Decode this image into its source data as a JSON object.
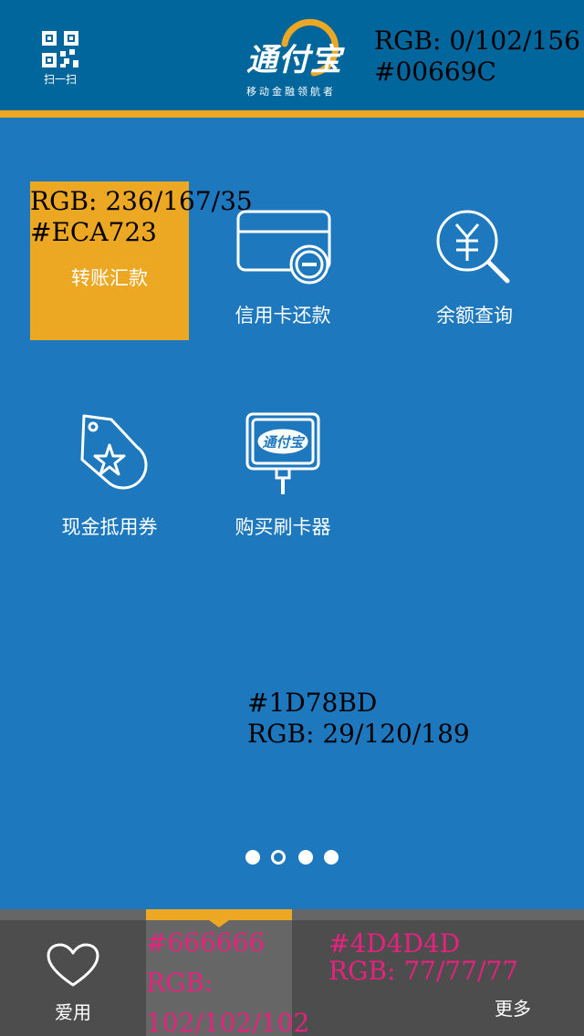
{
  "header": {
    "scan_label": "扫一扫",
    "logo_text": "通付宝",
    "logo_tagline": "移动金融领航者",
    "color_note": {
      "line1": "RGB: 0/102/156",
      "line2": "#00669C"
    }
  },
  "grid": {
    "items": [
      {
        "label": "转账汇款",
        "icon": "transfer-icon",
        "active": true
      },
      {
        "label": "信用卡还款",
        "icon": "credit-card-icon",
        "active": false
      },
      {
        "label": "余额查询",
        "icon": "yuan-search-icon",
        "active": false
      },
      {
        "label": "现金抵用券",
        "icon": "coupon-tag-icon",
        "active": false
      },
      {
        "label": "购买刷卡器",
        "icon": "card-reader-icon",
        "active": false
      }
    ],
    "active_note": {
      "line1": "RGB: 236/167/35",
      "line2": "#ECA723"
    },
    "background_note": {
      "line1": "#1D78BD",
      "line2": "RGB: 29/120/189"
    }
  },
  "pager": {
    "count": 4,
    "current": 2
  },
  "tabbar": {
    "tabs": [
      {
        "label": "爱用",
        "icon": "heart-icon"
      },
      {
        "label": "",
        "icon": ""
      },
      {
        "label": "",
        "icon": ""
      },
      {
        "label": "更多",
        "icon": ""
      }
    ],
    "mid_note": {
      "line1": "#666666",
      "line2": "RGB:",
      "line3": "102/102/102"
    },
    "bar_note": {
      "line1": "#4D4D4D",
      "line2": "RGB: 77/77/77"
    }
  },
  "colors": {
    "header": "#00669C",
    "accent": "#ECA723",
    "background": "#1D78BD",
    "tab_active": "#666666",
    "tabbar": "#4D4D4D",
    "annotation_pink": "#E8217E"
  }
}
